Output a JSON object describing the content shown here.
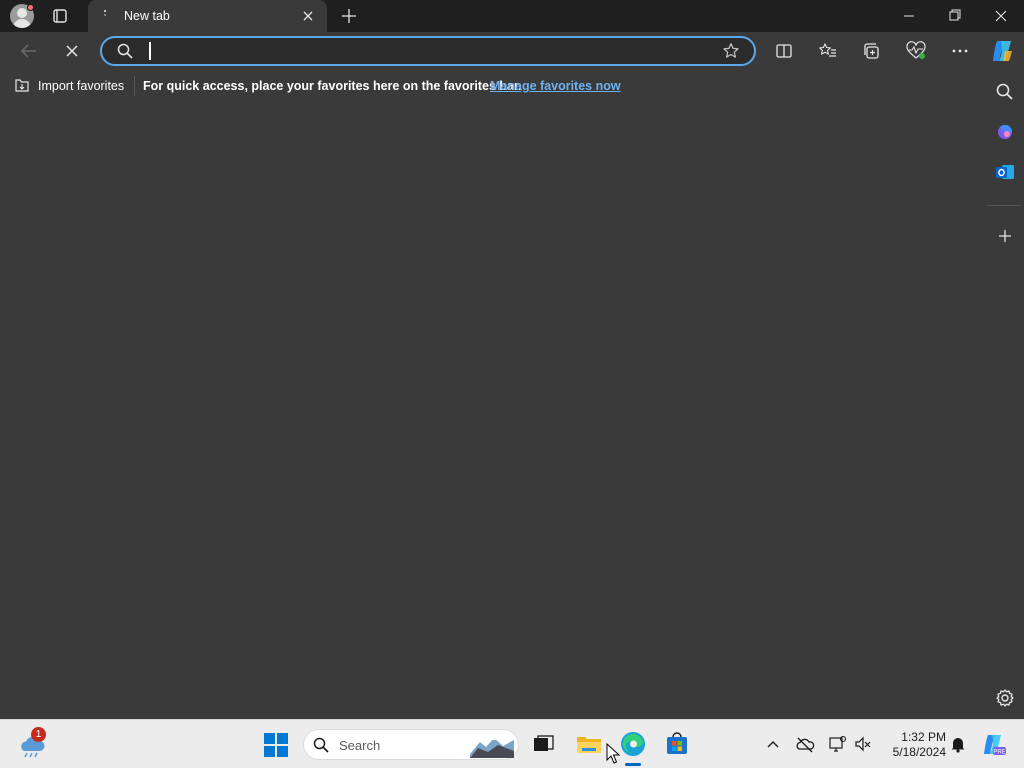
{
  "tab": {
    "title": "New tab"
  },
  "address_bar": {
    "value": "",
    "placeholder": ""
  },
  "favorites_bar": {
    "import_label": "Import favorites",
    "message": "For quick access, place your favorites here on the favorites bar.",
    "link_label": "Manage favorites now"
  },
  "taskbar": {
    "weather_badge": "1",
    "search_label": "Search",
    "time": "1:32 PM",
    "date": "5/18/2024"
  },
  "icons": [
    "profile-icon",
    "tab-actions-icon",
    "close-icon",
    "plus-icon",
    "minimize-icon",
    "maximize-icon",
    "back-arrow-icon",
    "stop-icon",
    "search-icon",
    "star-icon",
    "split-screen-icon",
    "favorites-icon",
    "collections-icon",
    "performance-icon",
    "more-icon",
    "copilot-icon",
    "import-icon",
    "outlook-icon",
    "settings-icon",
    "weather-icon",
    "windows-logo-icon",
    "task-view-icon",
    "file-explorer-icon",
    "edge-icon",
    "store-icon",
    "chevron-up-icon",
    "cloud-icon",
    "network-icon",
    "volume-icon",
    "notification-icon"
  ],
  "colors": {
    "accent": "#5aa8ea",
    "link": "#6fb1f0",
    "chrome_dark": "#1f1f1f",
    "content_bg": "#3a3a3a",
    "taskbar_bg": "#ececec",
    "badge_red": "#c42b1c"
  }
}
